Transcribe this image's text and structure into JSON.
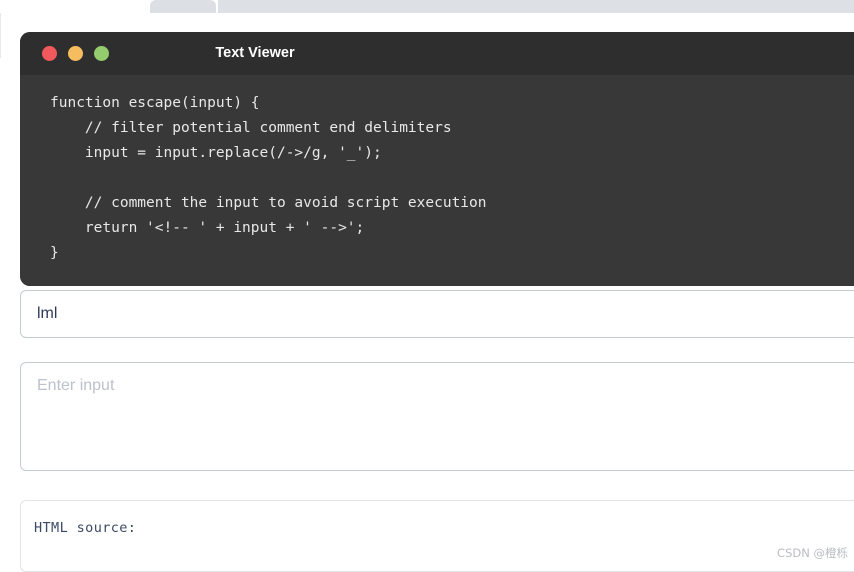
{
  "chrome": {
    "tab_placeholder": "",
    "address_bar_placeholder": ""
  },
  "code_window": {
    "title": "Text Viewer",
    "controls": [
      {
        "name": "close",
        "color": "#f2595c"
      },
      {
        "name": "minimize",
        "color": "#f5bd5e"
      },
      {
        "name": "maximize",
        "color": "#95cc6e"
      }
    ],
    "code": "function escape(input) {\n    // filter potential comment end delimiters\n    input = input.replace(/->/g, '_');\n\n    // comment the input to avoid script execution\n    return '<!-- ' + input + ' -->';\n}",
    "background": "#383838",
    "titlebar_background": "#2e2e2e",
    "text_color": "#e8e8e8"
  },
  "form": {
    "single_line_input": {
      "value": "lml",
      "placeholder": ""
    },
    "multi_line_input": {
      "value": "",
      "placeholder": "Enter input"
    },
    "source_panel": {
      "label": "HTML source:",
      "content": ""
    }
  },
  "watermark": {
    "text": "CSDN @橙栎"
  }
}
